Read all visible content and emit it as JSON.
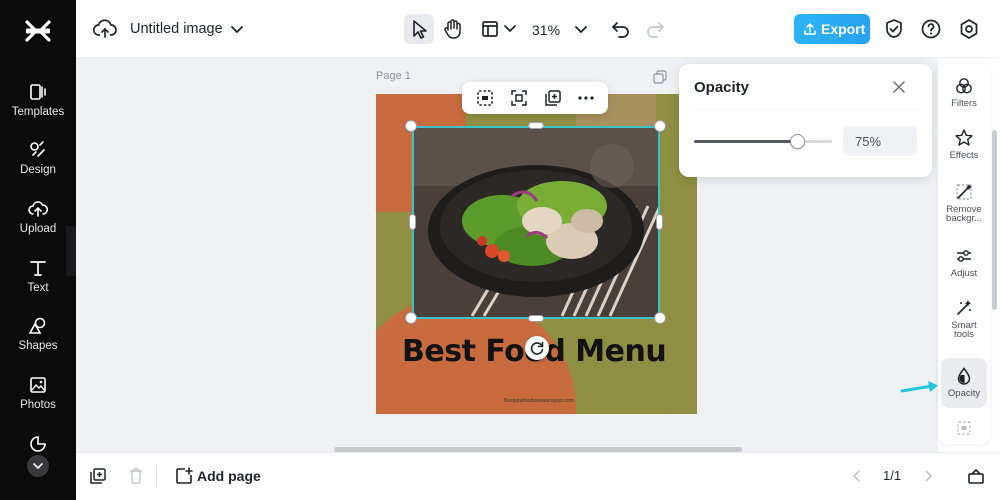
{
  "sidebar": {
    "items": [
      {
        "label": "Templates",
        "icon": "templates-icon"
      },
      {
        "label": "Design",
        "icon": "design-icon"
      },
      {
        "label": "Upload",
        "icon": "upload-icon"
      },
      {
        "label": "Text",
        "icon": "text-icon"
      },
      {
        "label": "Shapes",
        "icon": "shapes-icon"
      },
      {
        "label": "Photos",
        "icon": "photos-icon"
      }
    ]
  },
  "header": {
    "doc_title": "Untitled image",
    "zoom": "31%",
    "export_label": "Export"
  },
  "canvas": {
    "page_label": "Page 1",
    "design": {
      "title": "Best Food Menu",
      "url": "Bestpiralfooduxwwscopsot.com"
    }
  },
  "opacity_panel": {
    "title": "Opacity",
    "value": 75,
    "value_label": "75%"
  },
  "right_rail": {
    "items": [
      {
        "label": "Filters"
      },
      {
        "label": "Effects"
      },
      {
        "label": "Remove backgr..."
      },
      {
        "label": "Adjust"
      },
      {
        "label": "Smart tools"
      },
      {
        "label": "Opacity",
        "active": true
      }
    ]
  },
  "footer": {
    "add_page_label": "Add page",
    "page_count": "1/1"
  },
  "colors": {
    "accent": "#26a2ee",
    "selection": "#3bc3c9",
    "sidebar_bg": "#0b0b0c",
    "design_green": "#8e8f43",
    "design_orange": "#c86b3f",
    "annotation_arrow": "#1ec8d8"
  }
}
